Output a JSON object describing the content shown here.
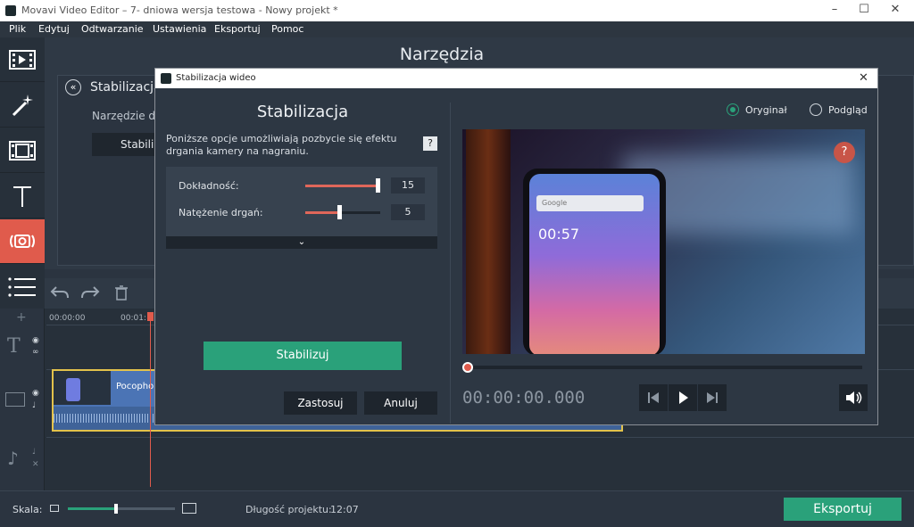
{
  "window": {
    "title": "Movavi Video Editor – 7- dniowa wersja testowa - Nowy projekt *"
  },
  "menu": [
    "Plik",
    "Edytuj",
    "Odtwarzanie",
    "Ustawienia",
    "Eksportuj",
    "Pomoc"
  ],
  "main": {
    "title": "Narzędzia",
    "section_title": "Stabilizacja",
    "description_partial": "Narzędzie do",
    "button_partial": "Stabili"
  },
  "timeline": {
    "time_start": "00:00:00",
    "time_tick2": "00:01:",
    "clip_label": "Pocopho"
  },
  "status": {
    "scale_label": "Skala:",
    "scale_value": 0.45,
    "duration_label": "Długość projektu:",
    "duration_value": "12:07",
    "export_label": "Eksportuj"
  },
  "dialog": {
    "title": "Stabilizacja wideo",
    "heading": "Stabilizacja",
    "description": "Poniższe opcje umożliwiają pozbycie się efektu drgania kamery na nagraniu.",
    "help": "?",
    "params": [
      {
        "label": "Dokładność:",
        "value": "15",
        "fill": 0.97
      },
      {
        "label": "Natężenie drgań:",
        "value": "5",
        "fill": 0.45
      }
    ],
    "stabilize_label": "Stabilizuj",
    "apply_label": "Zastosuj",
    "cancel_label": "Anuluj",
    "radio_original": "Oryginał",
    "radio_preview": "Podgląd",
    "timecode": "00:00:00.000",
    "preview_help": "?",
    "phone_search": "Google",
    "phone_time": "00:57"
  },
  "colors": {
    "accent": "#2aa17a",
    "active_tool": "#e05b4c",
    "slider": "#e0675a"
  }
}
